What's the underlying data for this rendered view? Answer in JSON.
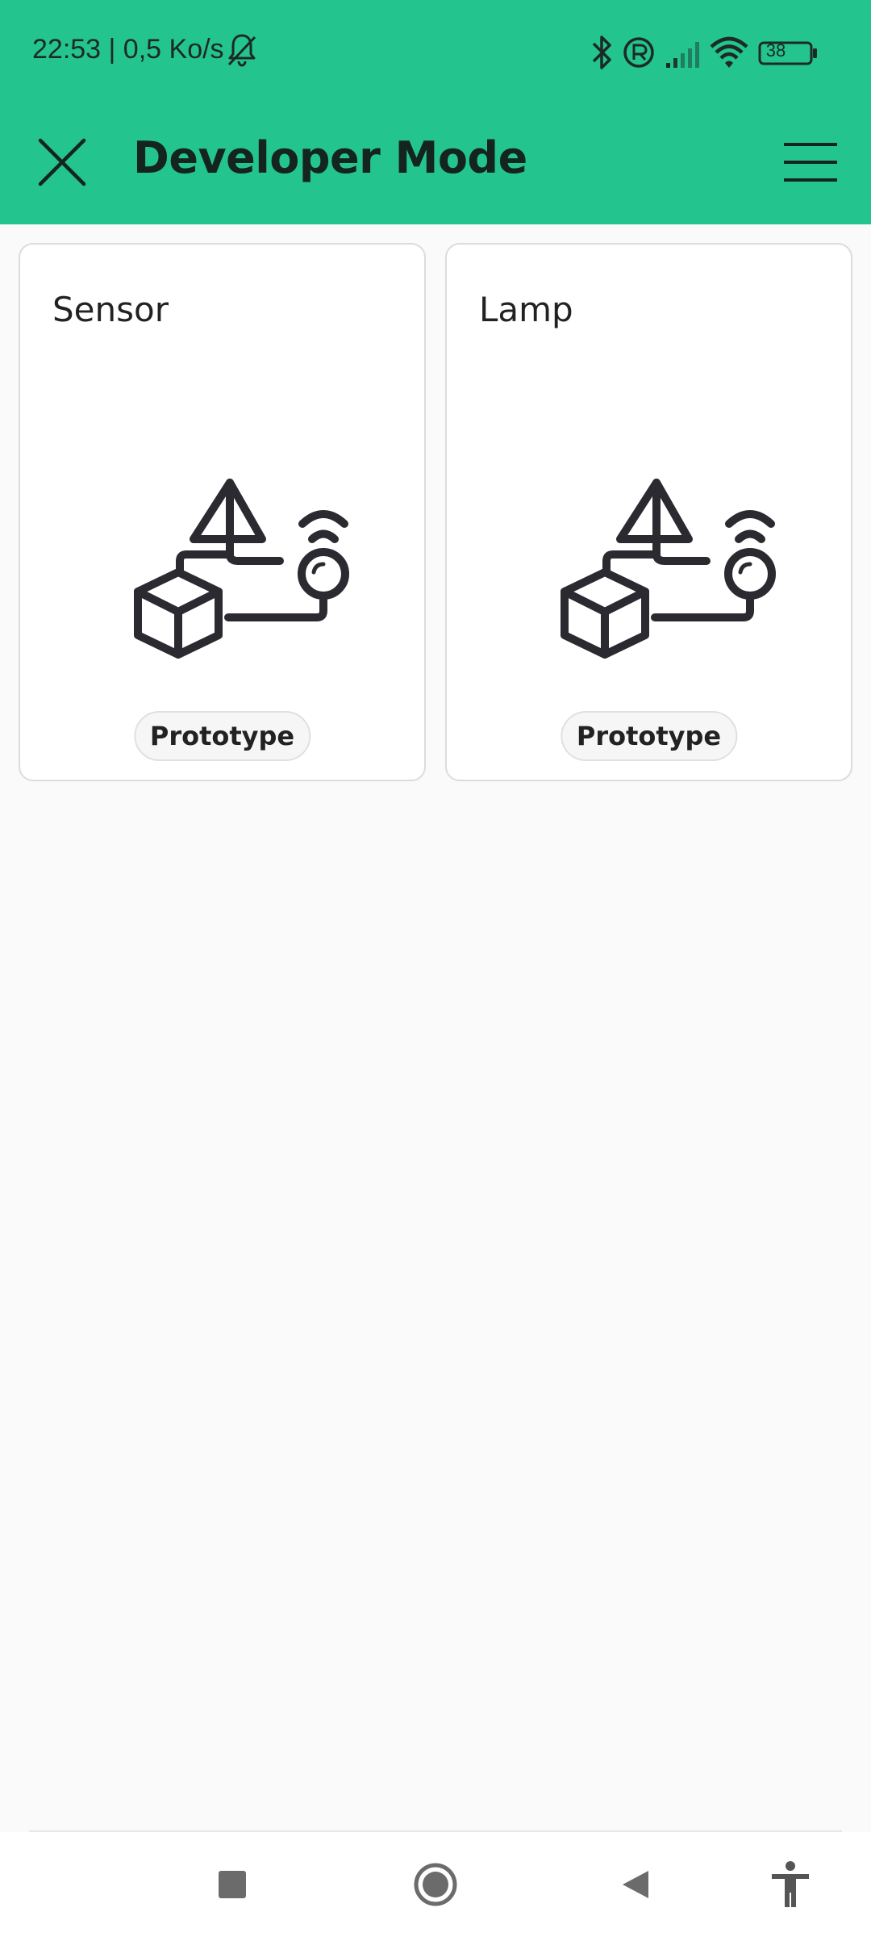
{
  "status_bar": {
    "time_text": "22:53 | 0,5 Ko/s",
    "battery_level": "38",
    "icons": [
      "bell-off-icon",
      "bluetooth-icon",
      "registered-icon",
      "signal-icon",
      "wifi-icon",
      "battery-icon"
    ]
  },
  "app_bar": {
    "title": "Developer Mode",
    "close_icon": "close-icon",
    "menu_icon": "menu-icon"
  },
  "cards": [
    {
      "title": "Sensor",
      "badge": "Prototype",
      "icon": "prototype-illustration"
    },
    {
      "title": "Lamp",
      "badge": "Prototype",
      "icon": "prototype-illustration"
    }
  ],
  "nav_bar": {
    "icons": [
      "recents-icon",
      "home-icon",
      "back-icon",
      "accessibility-icon"
    ]
  },
  "colors": {
    "accent": "#24c48e",
    "background": "#fafafa",
    "card_border": "#dcdcdc",
    "icon_dark": "#2a2a30"
  }
}
